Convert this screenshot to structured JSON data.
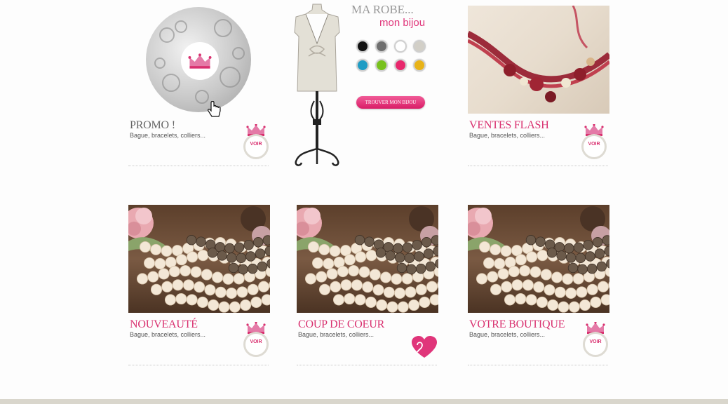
{
  "colors": {
    "brand_pink": "#d9306f",
    "muted_title": "#666666",
    "footer": "#d9d6cc"
  },
  "promo": {
    "title": "PROMO !",
    "subtitle": "Bague, bracelets, colliers...",
    "voir": "VOIR",
    "badge_icon": "crown-icon",
    "cursor_icon": "hand-pointer-icon"
  },
  "configurator": {
    "title": "MA ROBE...",
    "subtitle": "mon bijou",
    "swatches": [
      {
        "name": "black",
        "color": "#111111"
      },
      {
        "name": "grey",
        "color": "#6f6f6f"
      },
      {
        "name": "white",
        "color": "#ffffff"
      },
      {
        "name": "beige",
        "color": "#d2cfc7"
      },
      {
        "name": "blue",
        "color": "#1f9cc4"
      },
      {
        "name": "green",
        "color": "#78c11d"
      },
      {
        "name": "pink",
        "color": "#e8286d"
      },
      {
        "name": "yellow",
        "color": "#e8b318"
      }
    ],
    "cta": "TROUVER MON BIJOU"
  },
  "cards": [
    {
      "title": "VENTES FLASH",
      "subtitle": "Bague, bracelets, colliers...",
      "voir": "VOIR",
      "image": "necklace-photo"
    },
    {
      "title": "NOUVEAUTÉ",
      "subtitle": "Bague, bracelets, colliers...",
      "voir": "VOIR",
      "image": "pearls-photo"
    },
    {
      "title": "COUP DE COEUR",
      "subtitle": "Bague, bracelets, colliers...",
      "image": "pearls-photo",
      "badge_icon": "heart-icon"
    },
    {
      "title": "VOTRE BOUTIQUE",
      "subtitle": "Bague, bracelets, colliers...",
      "voir": "VOIR",
      "image": "pearls-photo"
    }
  ]
}
